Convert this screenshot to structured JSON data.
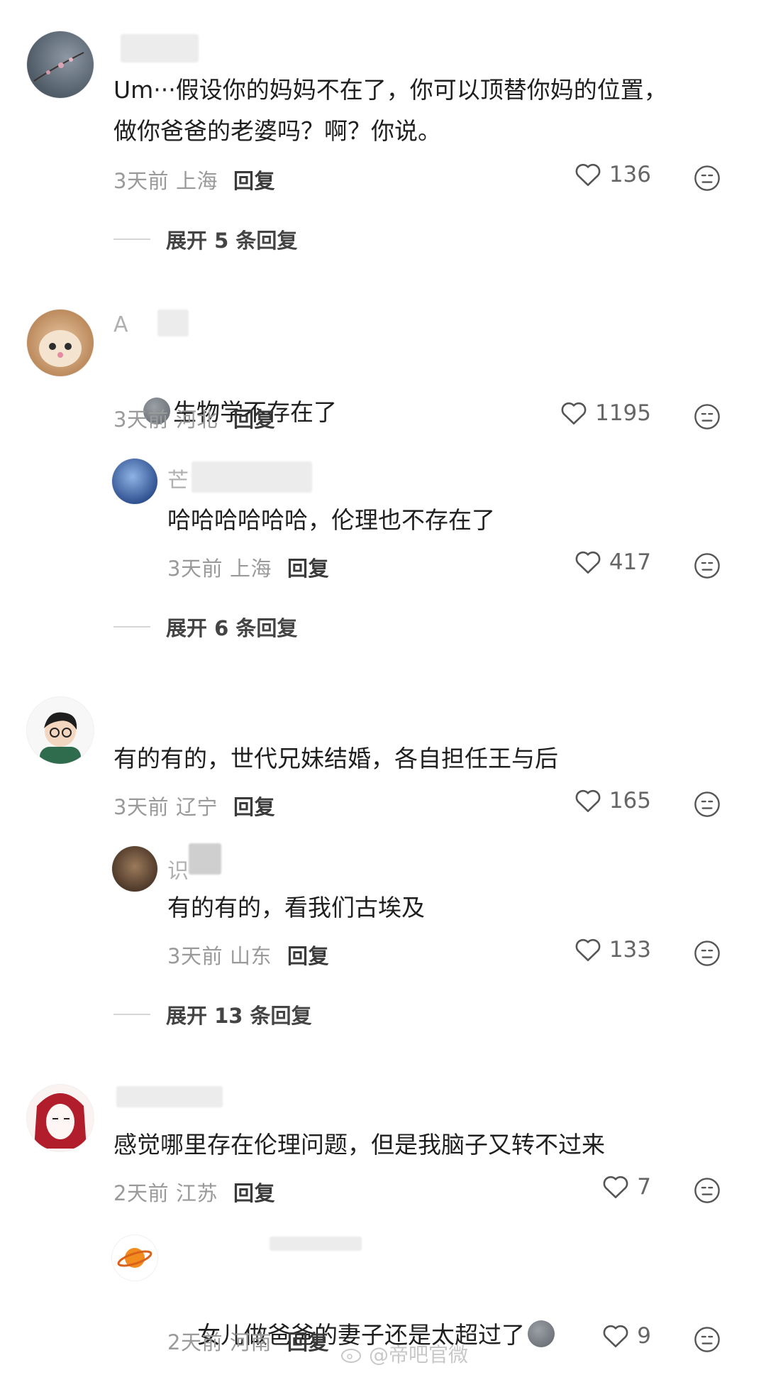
{
  "comments": [
    {
      "username": "",
      "text": "Um···假设你的妈妈不在了，你可以顶替你妈的位置，\n做你爸爸的老婆吗？啊？你说。",
      "time": "3天前",
      "location": "上海",
      "reply_label": "回复",
      "likes": "136",
      "expand": "展开 5 条回复"
    },
    {
      "username": "A",
      "text": "生物学不存在了",
      "time": "3天前",
      "location": "河北",
      "reply_label": "回复",
      "likes": "1195",
      "reply": {
        "username": "芒",
        "text": "哈哈哈哈哈哈，伦理也不存在了",
        "time": "3天前",
        "location": "上海",
        "reply_label": "回复",
        "likes": "417"
      },
      "expand": "展开 6 条回复"
    },
    {
      "username": "",
      "text": "有的有的，世代兄妹结婚，各自担任王与后",
      "time": "3天前",
      "location": "辽宁",
      "reply_label": "回复",
      "likes": "165",
      "reply": {
        "username": "识",
        "text": "有的有的，看我们古埃及",
        "time": "3天前",
        "location": "山东",
        "reply_label": "回复",
        "likes": "133"
      },
      "expand": "展开 13 条回复"
    },
    {
      "username": "",
      "text": "感觉哪里存在伦理问题，但是我脑子又转不过来",
      "time": "2天前",
      "location": "江苏",
      "reply_label": "回复",
      "likes": "7",
      "reply": {
        "username": "",
        "text": "女儿做爸爸的妻子还是太超过了",
        "time": "2天前",
        "location": "河南",
        "reply_label": "回复",
        "likes": "9"
      }
    }
  ],
  "icons": {
    "like": "heart-outline-icon",
    "react": "neutral-face-icon",
    "emoji": "pigeon-emoji-icon"
  },
  "watermark": "@帝吧官微"
}
